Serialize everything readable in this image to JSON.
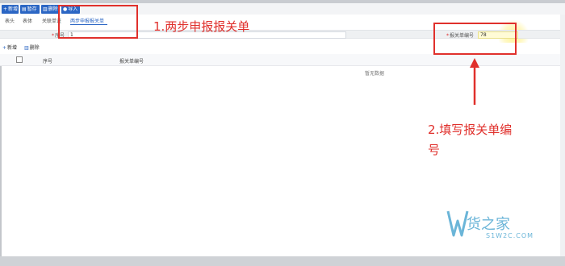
{
  "toolbar": {
    "buttons": [
      {
        "icon": "plus-icon",
        "label": "新增"
      },
      {
        "icon": "save-icon",
        "label": "暂存"
      },
      {
        "icon": "trash-icon",
        "label": "删除"
      },
      {
        "icon": "user-icon",
        "label": "导入"
      }
    ]
  },
  "tabs": [
    "表头",
    "表体",
    "关联单证",
    "两步申报报关单"
  ],
  "active_tab": "两步申报报关单",
  "form": {
    "field1_label": "序号",
    "field1_value": "1",
    "field2_label": "报关单编号",
    "field2_value": "78"
  },
  "subtools": {
    "add": "新增",
    "delete": "删除"
  },
  "table": {
    "columns": [
      "序号",
      "报关单编号"
    ],
    "empty_text": "暂无数据"
  },
  "annotations": {
    "step1": "1.两步申报报关单",
    "step2_line1": "2.填写报关单编",
    "step2_line2": "号"
  },
  "watermark": {
    "text": "货之家",
    "sub": "S1W2C.COM"
  },
  "colors": {
    "primary": "#2b66c4",
    "annotation": "#e0302c",
    "highlight": "#fffbd6",
    "watermark": "#6bb5d8"
  }
}
